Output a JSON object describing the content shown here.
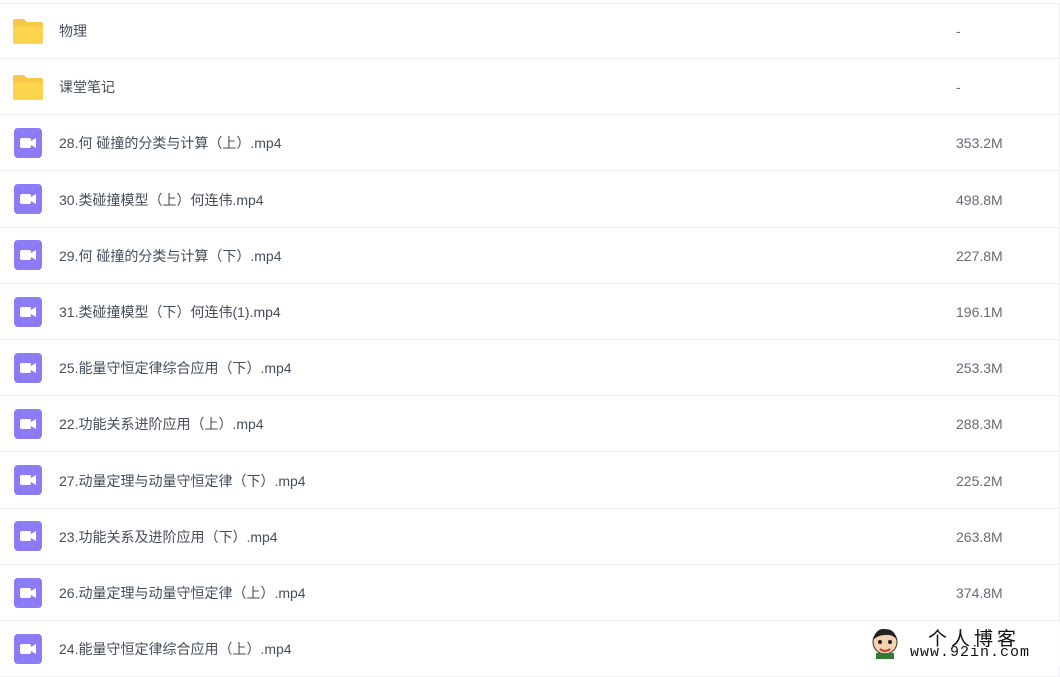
{
  "files": [
    {
      "name": "物理",
      "size": "-",
      "type": "folder",
      "icon": "folder-icon"
    },
    {
      "name": "课堂笔记",
      "size": "-",
      "type": "folder",
      "icon": "folder-icon"
    },
    {
      "name": "28.何 碰撞的分类与计算（上）.mp4",
      "size": "353.2M",
      "type": "video",
      "icon": "video-file-icon"
    },
    {
      "name": "30.类碰撞模型（上）何连伟.mp4",
      "size": "498.8M",
      "type": "video",
      "icon": "video-file-icon"
    },
    {
      "name": "29.何 碰撞的分类与计算（下）.mp4",
      "size": "227.8M",
      "type": "video",
      "icon": "video-file-icon"
    },
    {
      "name": "31.类碰撞模型（下）何连伟(1).mp4",
      "size": "196.1M",
      "type": "video",
      "icon": "video-file-icon"
    },
    {
      "name": "25.能量守恒定律综合应用（下）.mp4",
      "size": "253.3M",
      "type": "video",
      "icon": "video-file-icon"
    },
    {
      "name": "22.功能关系进阶应用（上）.mp4",
      "size": "288.3M",
      "type": "video",
      "icon": "video-file-icon"
    },
    {
      "name": "27.动量定理与动量守恒定律（下）.mp4",
      "size": "225.2M",
      "type": "video",
      "icon": "video-file-icon"
    },
    {
      "name": "23.功能关系及进阶应用（下）.mp4",
      "size": "263.8M",
      "type": "video",
      "icon": "video-file-icon"
    },
    {
      "name": "26.动量定理与动量守恒定律（上）.mp4",
      "size": "374.8M",
      "type": "video",
      "icon": "video-file-icon"
    },
    {
      "name": "24.能量守恒定律综合应用（上）.mp4",
      "size": "",
      "type": "video",
      "icon": "video-file-icon"
    }
  ],
  "watermark": {
    "title": "个人博客",
    "url": "www.92in.com"
  },
  "colors": {
    "folder": "#fcd34d",
    "video": "#8b7cf6",
    "text": "#454d5a"
  }
}
